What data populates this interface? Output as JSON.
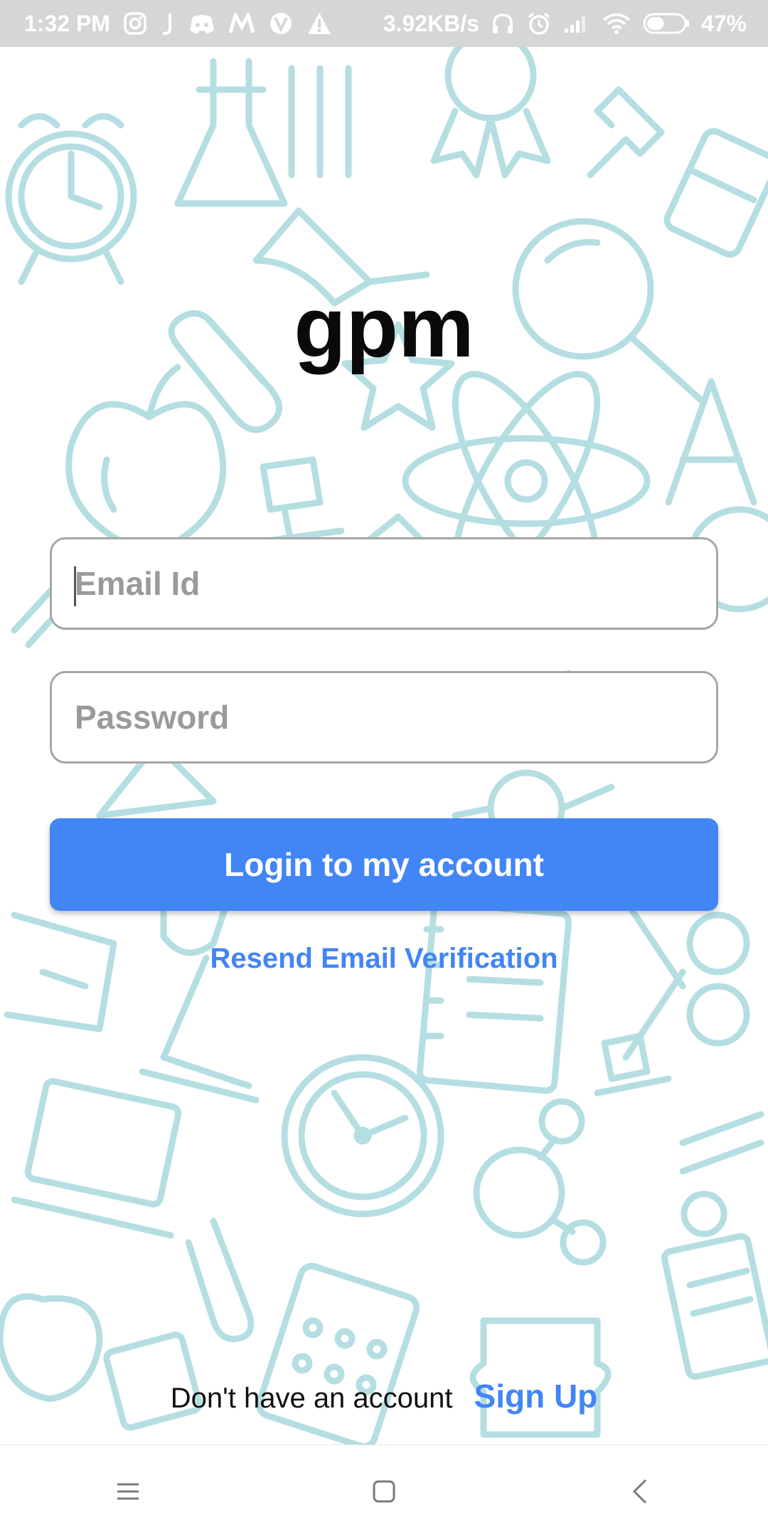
{
  "status_bar": {
    "time": "1:32 PM",
    "network_speed": "3.92KB/s",
    "battery_percent": "47%",
    "battery_level": 0.47,
    "icons": [
      "instagram-icon",
      "j-app-icon",
      "discord-icon",
      "m-app-icon",
      "vpn-icon",
      "warning-icon",
      "headphones-icon",
      "alarm-icon",
      "signal-icon",
      "wifi-icon",
      "battery-icon"
    ]
  },
  "app": {
    "title": "gpm"
  },
  "login_form": {
    "email_placeholder": "Email Id",
    "email_value": "",
    "password_placeholder": "Password",
    "password_value": "",
    "login_label": "Login to my account",
    "resend_label": "Resend Email Verification"
  },
  "signup": {
    "prompt": "Don't have an account",
    "link_label": "Sign Up"
  },
  "navigation": {
    "icons": [
      "menu-icon",
      "home-square-icon",
      "back-chevron-icon"
    ]
  },
  "colors": {
    "accent": "#4285f4",
    "pattern": "#a8d8dd",
    "status_bar": "#d6d6d6",
    "field_border": "#a6a6a6"
  }
}
